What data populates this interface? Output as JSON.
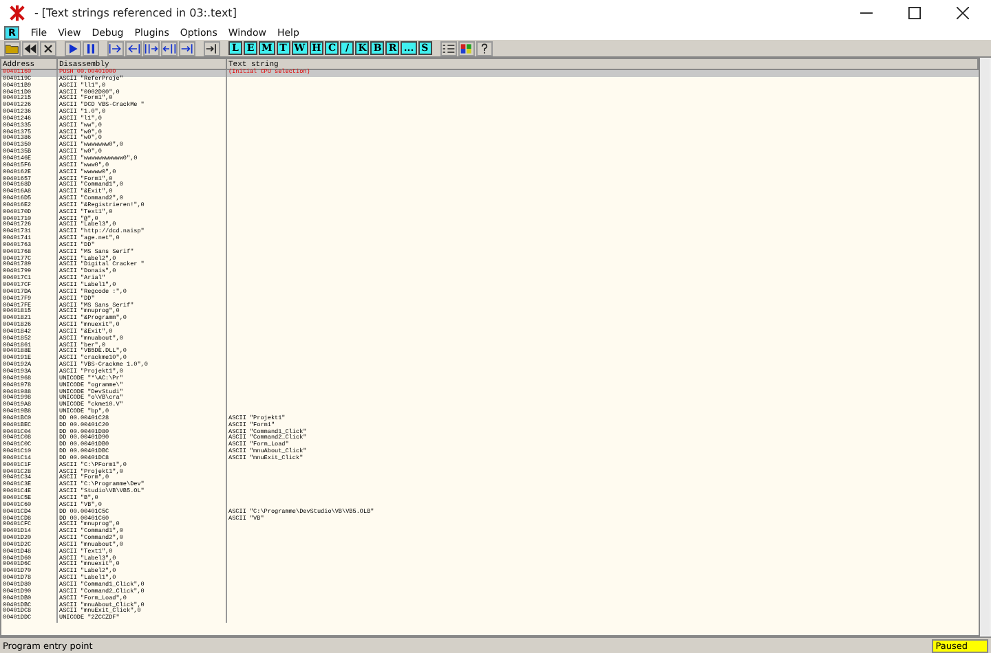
{
  "window": {
    "title": "- [Text strings referenced in 03:.text]"
  },
  "mdi_icon": "R",
  "menu": [
    "File",
    "View",
    "Debug",
    "Plugins",
    "Options",
    "Window",
    "Help"
  ],
  "toolbar_letters": [
    "L",
    "E",
    "M",
    "T",
    "W",
    "H",
    "C",
    "/",
    "K",
    "B",
    "R",
    "...",
    "S"
  ],
  "table": {
    "columns": [
      "Address",
      "Disassembly",
      "Text string"
    ],
    "rows": [
      {
        "address": "00401160",
        "disassembly": "PUSH 00.00401000",
        "text_string": "(Initial CPU selection)",
        "selected": true
      },
      {
        "address": "0040119C",
        "disassembly": "ASCII \"ReferProje\"",
        "selected": false
      },
      {
        "address": "004011B9",
        "disassembly": "ASCII \"ll1\",0",
        "selected": false
      },
      {
        "address": "004011D0",
        "disassembly": "ASCII \"0002D00\",0",
        "selected": false
      },
      {
        "address": "00401215",
        "disassembly": "ASCII \"Form1\",0",
        "selected": false
      },
      {
        "address": "00401226",
        "disassembly": "ASCII \"DCD VBS-CrackMe \"",
        "selected": false
      },
      {
        "address": "00401236",
        "disassembly": "ASCII \"1.0\",0",
        "selected": false
      },
      {
        "address": "00401246",
        "disassembly": "ASCII \"l1\",0",
        "selected": false
      },
      {
        "address": "00401335",
        "disassembly": "ASCII \"ww\",0",
        "selected": false
      },
      {
        "address": "00401375",
        "disassembly": "ASCII \"w0\",0",
        "selected": false
      },
      {
        "address": "00401386",
        "disassembly": "ASCII \"w0\",0",
        "selected": false
      },
      {
        "address": "00401350",
        "disassembly": "ASCII \"wwwwwww0\",0",
        "selected": false
      },
      {
        "address": "0040135B",
        "disassembly": "ASCII \"w0\",0",
        "selected": false
      },
      {
        "address": "0040146E",
        "disassembly": "ASCII \"wwwwwwwwwww0\",0",
        "selected": false
      },
      {
        "address": "004015F6",
        "disassembly": "ASCII \"www0\",0",
        "selected": false
      },
      {
        "address": "0040162E",
        "disassembly": "ASCII \"wwwww0\",0",
        "selected": false
      },
      {
        "address": "00401657",
        "disassembly": "ASCII \"Form1\",0",
        "selected": false
      },
      {
        "address": "0040168D",
        "disassembly": "ASCII \"Command1\",0",
        "selected": false
      },
      {
        "address": "004016A8",
        "disassembly": "ASCII \"&Exit\",0",
        "selected": false
      },
      {
        "address": "004016D5",
        "disassembly": "ASCII \"Command2\",0",
        "selected": false
      },
      {
        "address": "004016E2",
        "disassembly": "ASCII \"&Registrieren!\",0",
        "selected": false
      },
      {
        "address": "0040170D",
        "disassembly": "ASCII \"Text1\",0",
        "selected": false
      },
      {
        "address": "00401710",
        "disassembly": "ASCII \"@\",0",
        "selected": false
      },
      {
        "address": "00401726",
        "disassembly": "ASCII \"Label3\",0",
        "selected": false
      },
      {
        "address": "00401731",
        "disassembly": "ASCII \"http://dcd.naisp\"",
        "selected": false
      },
      {
        "address": "00401741",
        "disassembly": "ASCII \"age.net\",0",
        "selected": false
      },
      {
        "address": "00401763",
        "disassembly": "ASCII \"DD\"",
        "selected": false
      },
      {
        "address": "00401768",
        "disassembly": "ASCII \"MS Sans Serif\"",
        "selected": false
      },
      {
        "address": "0040177C",
        "disassembly": "ASCII \"Label2\",0",
        "selected": false
      },
      {
        "address": "00401789",
        "disassembly": "ASCII \"Digital Cracker \"",
        "selected": false
      },
      {
        "address": "00401799",
        "disassembly": "ASCII \"Donais\",0",
        "selected": false
      },
      {
        "address": "004017C1",
        "disassembly": "ASCII \"Arial\"",
        "selected": false
      },
      {
        "address": "004017CF",
        "disassembly": "ASCII \"Label1\",0",
        "selected": false
      },
      {
        "address": "004017DA",
        "disassembly": "ASCII \"Regcode :\",0",
        "selected": false
      },
      {
        "address": "004017F9",
        "disassembly": "ASCII \"DD\"",
        "selected": false
      },
      {
        "address": "004017FE",
        "disassembly": "ASCII \"MS Sans Serif\"",
        "selected": false
      },
      {
        "address": "00401815",
        "disassembly": "ASCII \"mnuprog\",0",
        "selected": false
      },
      {
        "address": "00401821",
        "disassembly": "ASCII \"&Programm\",0",
        "selected": false
      },
      {
        "address": "00401826",
        "disassembly": "ASCII \"mnuexit\",0",
        "selected": false
      },
      {
        "address": "00401842",
        "disassembly": "ASCII \"&Exit\",0",
        "selected": false
      },
      {
        "address": "00401852",
        "disassembly": "ASCII \"mnuabout\",0",
        "selected": false
      },
      {
        "address": "00401861",
        "disassembly": "ASCII \"ber\",0",
        "selected": false
      },
      {
        "address": "0040188E",
        "disassembly": "ASCII \"VB5DE.DLL\",0",
        "selected": false
      },
      {
        "address": "0040191E",
        "disassembly": "ASCII \"crackme10\",0",
        "selected": false
      },
      {
        "address": "0040192A",
        "disassembly": "ASCII \"VBS-Crackme 1.0\",0",
        "selected": false
      },
      {
        "address": "0040193A",
        "disassembly": "ASCII \"Projekt1\",0",
        "selected": false
      },
      {
        "address": "00401968",
        "disassembly": "UNICODE \"*\\AC:\\Pr\"",
        "selected": false
      },
      {
        "address": "00401978",
        "disassembly": "UNICODE \"ogramme\\\"",
        "selected": false
      },
      {
        "address": "00401988",
        "disassembly": "UNICODE \"DevStudi\"",
        "selected": false
      },
      {
        "address": "00401998",
        "disassembly": "UNICODE \"o\\VB\\cra\"",
        "selected": false
      },
      {
        "address": "004019A8",
        "disassembly": "UNICODE \"ckme10.V\"",
        "selected": false
      },
      {
        "address": "004019B8",
        "disassembly": "UNICODE \"bp\",0",
        "selected": false
      },
      {
        "address": "00401BC0",
        "disassembly": "DD 00.00401C28",
        "text_string": "ASCII \"Projekt1\"",
        "selected": false
      },
      {
        "address": "00401BEC",
        "disassembly": "DD 00.00401C20",
        "text_string": "ASCII \"Form1\"",
        "selected": false
      },
      {
        "address": "00401C04",
        "disassembly": "DD 00.00401D80",
        "text_string": "ASCII \"Command1_Click\"",
        "selected": false
      },
      {
        "address": "00401C08",
        "disassembly": "DD 00.00401D90",
        "text_string": "ASCII \"Command2_Click\"",
        "selected": false
      },
      {
        "address": "00401C0C",
        "disassembly": "DD 00.00401DB0",
        "text_string": "ASCII \"Form_Load\"",
        "selected": false
      },
      {
        "address": "00401C10",
        "disassembly": "DD 00.00401DBC",
        "text_string": "ASCII \"mnuAbout_Click\"",
        "selected": false
      },
      {
        "address": "00401C14",
        "disassembly": "DD 00.00401DC8",
        "text_string": "ASCII \"mnuExit_Click\"",
        "selected": false
      },
      {
        "address": "00401C1F",
        "disassembly": "ASCII \"C:\\PForm1\",0",
        "selected": false
      },
      {
        "address": "00401C28",
        "disassembly": "ASCII \"Projekt1\",0",
        "selected": false
      },
      {
        "address": "00401C34",
        "disassembly": "ASCII \"Form\",0",
        "selected": false
      },
      {
        "address": "00401C3E",
        "disassembly": "ASCII \"C:\\Programme\\Dev\"",
        "selected": false
      },
      {
        "address": "00401C4E",
        "disassembly": "ASCII \"Studio\\VB\\VB5.OL\"",
        "selected": false
      },
      {
        "address": "00401C5E",
        "disassembly": "ASCII \"B\",0",
        "selected": false
      },
      {
        "address": "00401C60",
        "disassembly": "ASCII \"VB\",0",
        "selected": false
      },
      {
        "address": "00401CD4",
        "disassembly": "DD 00.00401C5C",
        "text_string": "ASCII \"C:\\Programme\\DevStudio\\VB\\VB5.OLB\"",
        "selected": false
      },
      {
        "address": "00401CD8",
        "disassembly": "DD 00.00401C60",
        "text_string": "ASCII \"VB\"",
        "selected": false
      },
      {
        "address": "00401CFC",
        "disassembly": "ASCII \"mnuprog\",0",
        "selected": false
      },
      {
        "address": "00401D14",
        "disassembly": "ASCII \"Command1\",0",
        "selected": false
      },
      {
        "address": "00401D20",
        "disassembly": "ASCII \"Command2\",0",
        "selected": false
      },
      {
        "address": "00401D2C",
        "disassembly": "ASCII \"mnuabout\",0",
        "selected": false
      },
      {
        "address": "00401D48",
        "disassembly": "ASCII \"Text1\",0",
        "selected": false
      },
      {
        "address": "00401D60",
        "disassembly": "ASCII \"Label3\",0",
        "selected": false
      },
      {
        "address": "00401D6C",
        "disassembly": "ASCII \"mnuexit\",0",
        "selected": false
      },
      {
        "address": "00401D70",
        "disassembly": "ASCII \"Label2\",0",
        "selected": false
      },
      {
        "address": "00401D78",
        "disassembly": "ASCII \"Label1\",0",
        "selected": false
      },
      {
        "address": "00401D80",
        "disassembly": "ASCII \"Command1_Click\",0",
        "selected": false
      },
      {
        "address": "00401D90",
        "disassembly": "ASCII \"Command2_Click\",0",
        "selected": false
      },
      {
        "address": "00401DB0",
        "disassembly": "ASCII \"Form_Load\",0",
        "selected": false
      },
      {
        "address": "00401DBC",
        "disassembly": "ASCII \"mnuAbout_Click\",0",
        "selected": false
      },
      {
        "address": "00401DC8",
        "disassembly": "ASCII \"mnuExit_Click\",0",
        "selected": false
      },
      {
        "address": "00401DDC",
        "disassembly": "UNICODE \"2ZCCZDF\"",
        "selected": false
      }
    ]
  },
  "status_bar": {
    "message": "Program entry point",
    "state": "Paused"
  }
}
